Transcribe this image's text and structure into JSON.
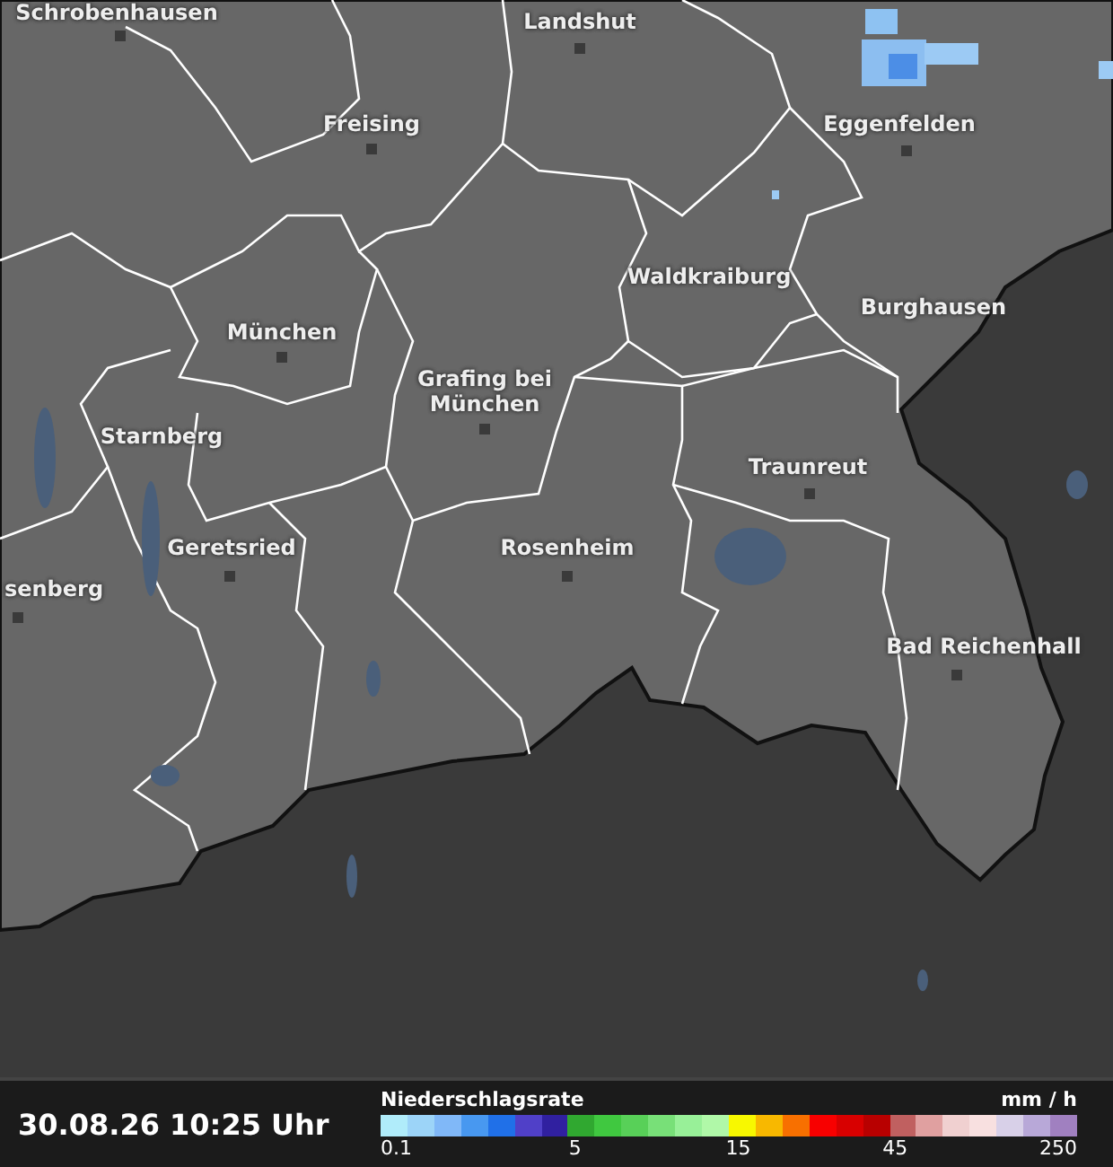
{
  "map": {
    "places": [
      {
        "name": "Schrobenhausen"
      },
      {
        "name": "Landshut"
      },
      {
        "name": "Freising"
      },
      {
        "name": "Eggenfelden"
      },
      {
        "name": "Waldkraiburg"
      },
      {
        "name": "Burghausen"
      },
      {
        "name": "München"
      },
      {
        "name": "Grafing bei München"
      },
      {
        "name": "Starnberg"
      },
      {
        "name": "Traunreut"
      },
      {
        "name": "Geretsried"
      },
      {
        "name": "Rosenheim"
      },
      {
        "name": "senberg"
      },
      {
        "name": "Bad Reichenhall"
      }
    ]
  },
  "footer": {
    "timestamp": "30.08.26 10:25 Uhr",
    "legend": {
      "title": "Niederschlagsrate",
      "unit": "mm / h",
      "swatches": [
        {
          "color": "#b0ecfa",
          "tick": "0.1"
        },
        {
          "color": "#9cd4f8"
        },
        {
          "color": "#80b8f8"
        },
        {
          "color": "#4898f0"
        },
        {
          "color": "#2070e8"
        },
        {
          "color": "#5040c8"
        },
        {
          "color": "#3020a0"
        },
        {
          "color": "#30a830",
          "tick": "5"
        },
        {
          "color": "#40c840"
        },
        {
          "color": "#58d058"
        },
        {
          "color": "#78e078"
        },
        {
          "color": "#98f098"
        },
        {
          "color": "#b0f8a8"
        },
        {
          "color": "#f8f800",
          "tick": "15"
        },
        {
          "color": "#f8b800"
        },
        {
          "color": "#f87000"
        },
        {
          "color": "#f80000"
        },
        {
          "color": "#d80000"
        },
        {
          "color": "#b80000"
        },
        {
          "color": "#c06060",
          "tick": "45"
        },
        {
          "color": "#e0a0a0"
        },
        {
          "color": "#f0d0d0"
        },
        {
          "color": "#f8e0e0"
        },
        {
          "color": "#d8d0e8"
        },
        {
          "color": "#b8a8d8"
        },
        {
          "color": "#a080c0",
          "tick": "250"
        }
      ]
    }
  }
}
